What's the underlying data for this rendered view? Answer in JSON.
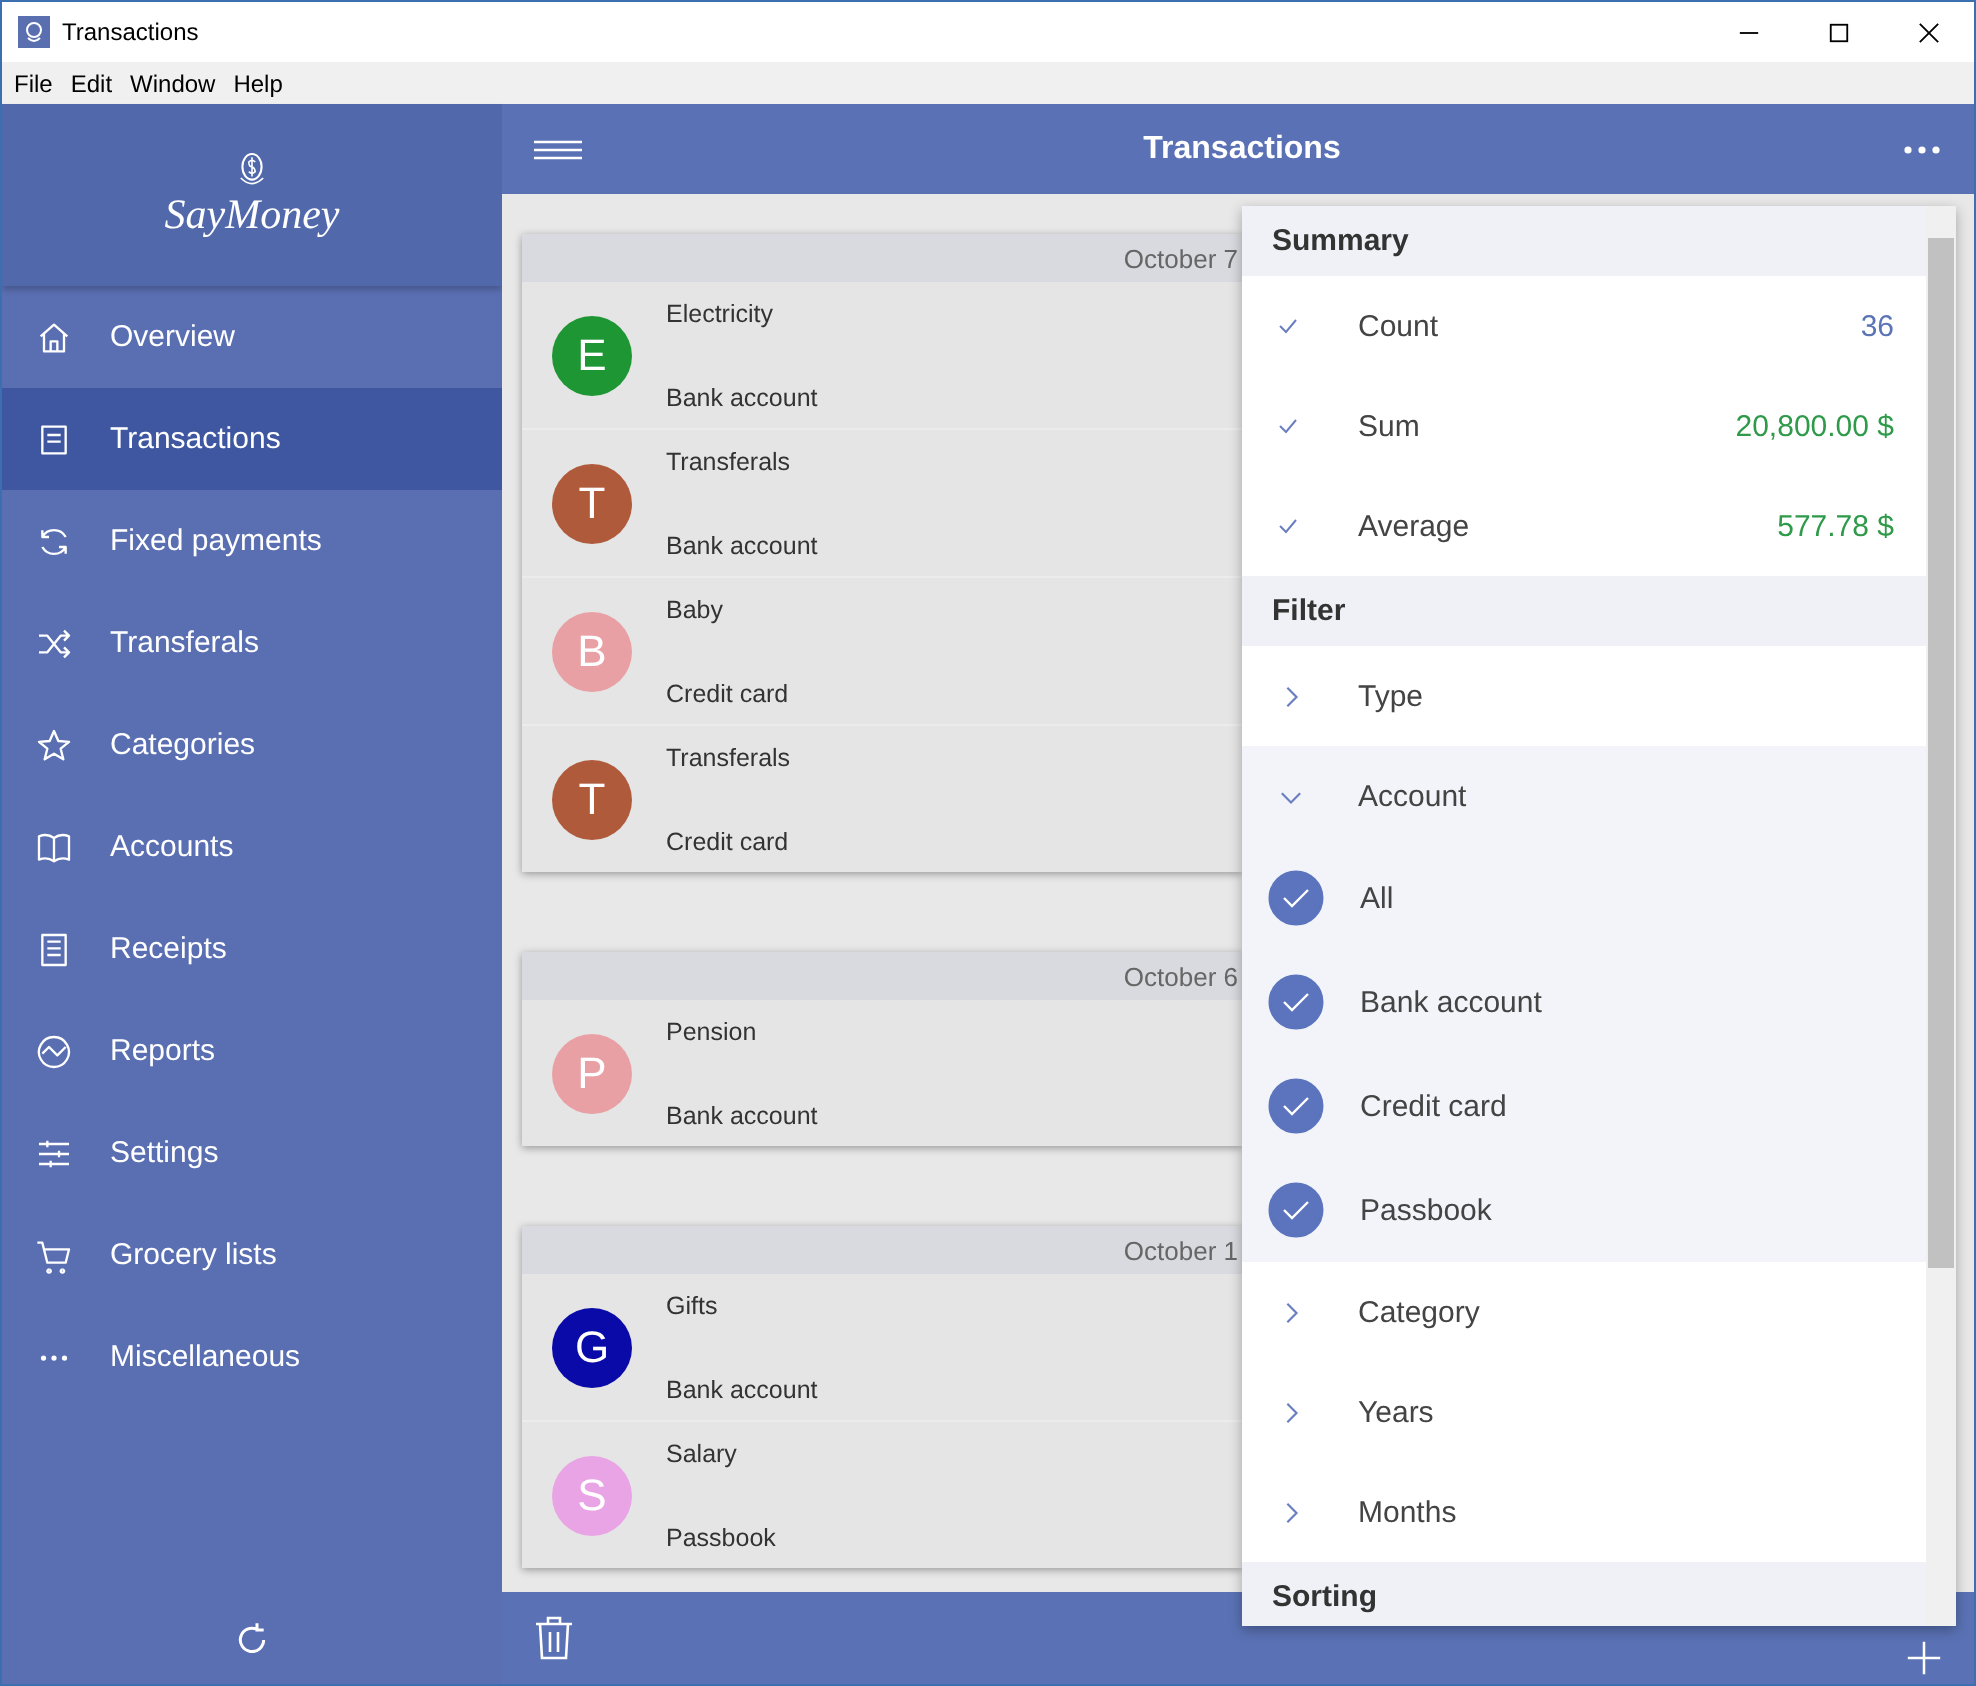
{
  "window": {
    "title": "Transactions"
  },
  "menu": [
    "File",
    "Edit",
    "Window",
    "Help"
  ],
  "sidebar": {
    "logo": "SayMoney",
    "items": [
      {
        "label": "Overview",
        "selected": false
      },
      {
        "label": "Transactions",
        "selected": true
      },
      {
        "label": "Fixed payments",
        "selected": false
      },
      {
        "label": "Transferals",
        "selected": false
      },
      {
        "label": "Categories",
        "selected": false
      },
      {
        "label": "Accounts",
        "selected": false
      },
      {
        "label": "Receipts",
        "selected": false
      },
      {
        "label": "Reports",
        "selected": false
      },
      {
        "label": "Settings",
        "selected": false
      },
      {
        "label": "Grocery lists",
        "selected": false
      },
      {
        "label": "Miscellaneous",
        "selected": false
      }
    ]
  },
  "header": {
    "title": "Transactions"
  },
  "groups": [
    {
      "date": "October 7",
      "transactions": [
        {
          "initial": "E",
          "color": "#1e9634",
          "category": "Electricity",
          "account": "Bank account"
        },
        {
          "initial": "T",
          "color": "#b05a3c",
          "category": "Transferals",
          "account": "Bank account"
        },
        {
          "initial": "B",
          "color": "#e8a0a4",
          "category": "Baby",
          "account": "Credit card"
        },
        {
          "initial": "T",
          "color": "#b05a3c",
          "category": "Transferals",
          "account": "Credit card"
        }
      ]
    },
    {
      "date": "October 6",
      "transactions": [
        {
          "initial": "P",
          "color": "#e8a0a4",
          "category": "Pension",
          "account": "Bank account"
        }
      ]
    },
    {
      "date": "October 1",
      "transactions": [
        {
          "initial": "G",
          "color": "#0a0aa8",
          "category": "Gifts",
          "account": "Bank account"
        },
        {
          "initial": "S",
          "color": "#e8a4e4",
          "category": "Salary",
          "account": "Passbook"
        }
      ]
    }
  ],
  "panel": {
    "summary": {
      "title": "Summary",
      "items": [
        {
          "label": "Count",
          "value": "36",
          "checked": true,
          "color": "#5b74b6"
        },
        {
          "label": "Sum",
          "value": "20,800.00 $",
          "checked": true,
          "color": "#2e9a4a"
        },
        {
          "label": "Average",
          "value": "577.78 $",
          "checked": true,
          "color": "#2e9a4a"
        }
      ]
    },
    "filter": {
      "title": "Filter",
      "items": [
        {
          "label": "Type",
          "expanded": false
        },
        {
          "label": "Account",
          "expanded": true,
          "options": [
            {
              "label": "All",
              "checked": true
            },
            {
              "label": "Bank account",
              "checked": true
            },
            {
              "label": "Credit card",
              "checked": true
            },
            {
              "label": "Passbook",
              "checked": true
            }
          ]
        },
        {
          "label": "Category",
          "expanded": false
        },
        {
          "label": "Years",
          "expanded": false
        },
        {
          "label": "Months",
          "expanded": false
        }
      ]
    },
    "sorting": {
      "title": "Sorting"
    }
  }
}
